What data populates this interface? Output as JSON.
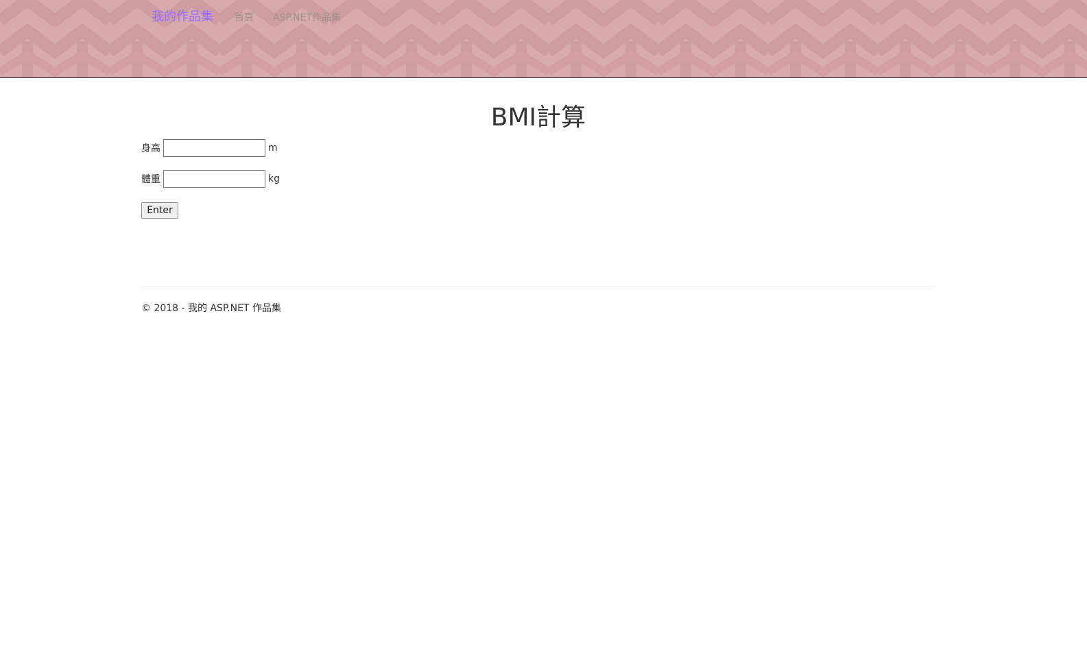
{
  "navbar": {
    "brand": "我的作品集",
    "links": [
      {
        "label": "首頁"
      },
      {
        "label": "ASP.NET作品集"
      }
    ]
  },
  "main": {
    "title": "BMI計算",
    "fields": [
      {
        "label": "身高",
        "value": "",
        "unit": "m"
      },
      {
        "label": "體重",
        "value": "",
        "unit": "kg"
      }
    ],
    "submit_label": "Enter"
  },
  "footer": {
    "text": "© 2018 - 我的 ASP.NET 作品集"
  },
  "colors": {
    "navbar_bg": "#d7aaaa",
    "brand_text": "#9b6cf0",
    "nav_link_text": "#a08f8f",
    "body_text": "#333333"
  }
}
